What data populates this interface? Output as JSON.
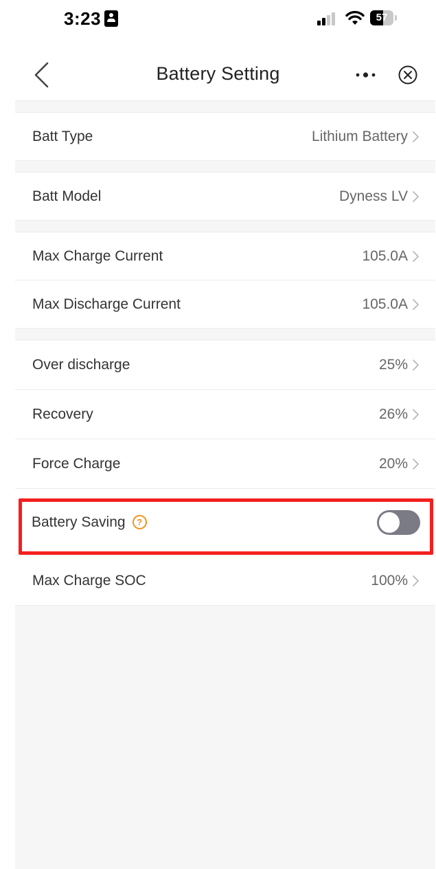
{
  "status_bar": {
    "time": "3:23",
    "battery_level": "57"
  },
  "nav": {
    "title": "Battery Setting"
  },
  "groups": [
    [
      {
        "label": "Batt Type",
        "value": "Lithium Battery"
      }
    ],
    [
      {
        "label": "Batt Model",
        "value": "Dyness LV"
      }
    ],
    [
      {
        "label": "Max Charge Current",
        "value": "105.0A"
      },
      {
        "label": "Max Discharge Current",
        "value": "105.0A"
      }
    ],
    [
      {
        "label": "Over discharge",
        "value": "25%"
      },
      {
        "label": "Recovery",
        "value": "26%"
      },
      {
        "label": "Force Charge",
        "value": "20%"
      }
    ]
  ],
  "battery_saving": {
    "label": "Battery Saving",
    "help_icon": "question-circle-icon",
    "enabled": false
  },
  "max_charge_soc": {
    "label": "Max Charge SOC",
    "value": "100%"
  },
  "colors": {
    "accent_help": "#f0921d",
    "highlight_box": "#f41f1f",
    "toggle_off": "#7b7b86"
  }
}
